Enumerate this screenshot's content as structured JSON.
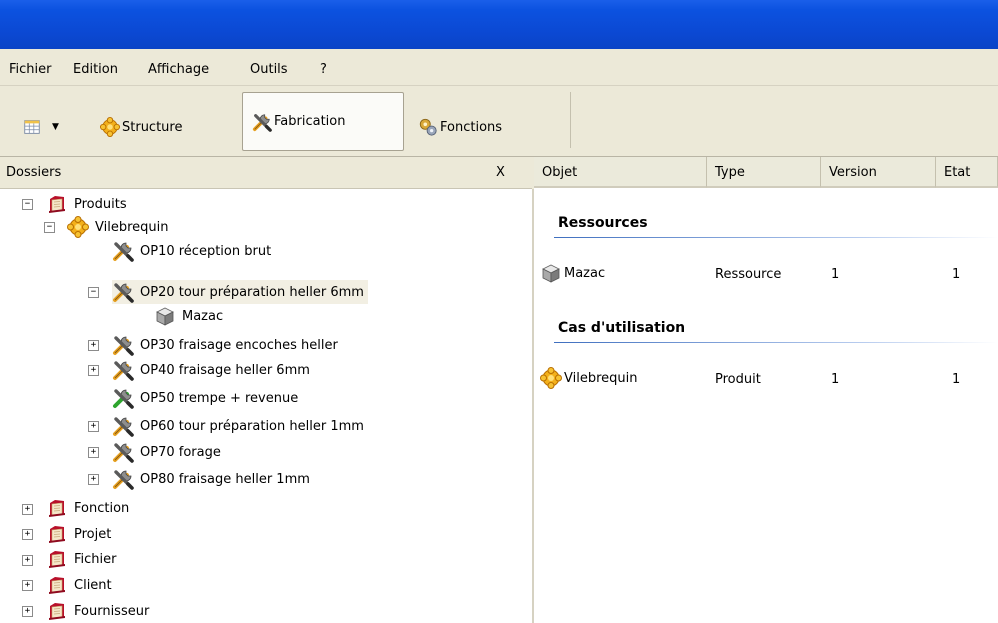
{
  "menu": [
    "Fichier",
    "Edition",
    "Affichage",
    "Outils",
    "?"
  ],
  "toolbar": {
    "structure": "Structure",
    "fabrication": "Fabrication",
    "fonctions": "Fonctions"
  },
  "left_header": {
    "title": "Dossiers",
    "close": "X"
  },
  "tree": [
    {
      "label": "Produits"
    },
    {
      "label": "Vilebrequin"
    },
    {
      "label": "OP10 réception brut"
    },
    {
      "label": "OP20 tour préparation heller 6mm"
    },
    {
      "label": "Mazac"
    },
    {
      "label": "OP30 fraisage encoches heller"
    },
    {
      "label": "OP40 fraisage heller 6mm"
    },
    {
      "label": "OP50 trempe + revenue"
    },
    {
      "label": "OP60 tour préparation heller 1mm"
    },
    {
      "label": "OP70 forage"
    },
    {
      "label": "OP80 fraisage heller 1mm"
    },
    {
      "label": "Fonction"
    },
    {
      "label": "Projet"
    },
    {
      "label": "Fichier"
    },
    {
      "label": "Client"
    },
    {
      "label": "Fournisseur"
    }
  ],
  "columns": [
    "Objet",
    "Type",
    "Version",
    "Etat"
  ],
  "groups": [
    {
      "title": "Ressources",
      "rows": [
        {
          "objet": "Mazac",
          "type": "Ressource",
          "version": "1",
          "etat": "1"
        }
      ]
    },
    {
      "title": "Cas d'utilisation",
      "rows": [
        {
          "objet": "Vilebrequin",
          "type": "Produit",
          "version": "1",
          "etat": "1"
        }
      ]
    }
  ]
}
